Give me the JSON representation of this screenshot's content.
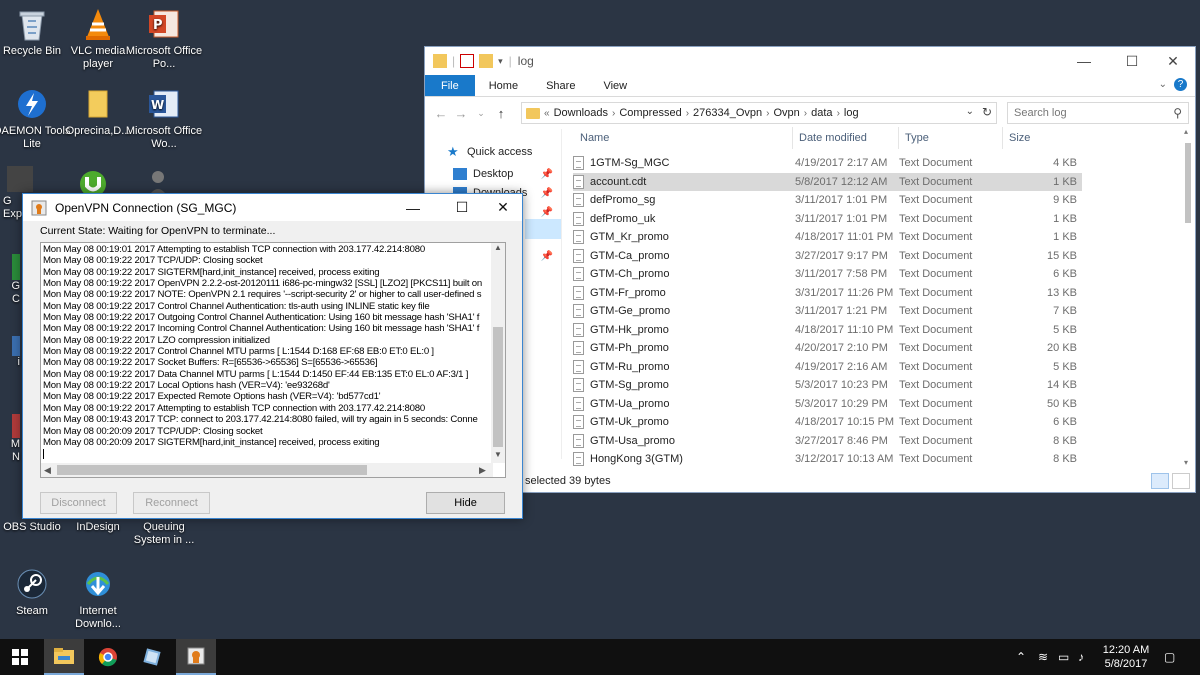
{
  "desktop": {
    "icons": [
      {
        "label": "Recycle Bin",
        "icon": "recycle-bin-icon"
      },
      {
        "label": "VLC media player",
        "icon": "vlc-cone-icon"
      },
      {
        "label": "Microsoft Office Po...",
        "icon": "powerpoint-icon"
      },
      {
        "label": "DAEMON Tools Lite",
        "icon": "daemon-tools-icon"
      },
      {
        "label": "Oprecina,D...",
        "icon": "folder-icon"
      },
      {
        "label": "Microsoft Office Wo...",
        "icon": "word-icon"
      },
      {
        "label": "OBS Studio",
        "icon": "obs-icon"
      },
      {
        "label": "InDesign",
        "icon": "indesign-icon"
      },
      {
        "label": "Queuing System in ...",
        "icon": "queuing-icon"
      },
      {
        "label": "Steam",
        "icon": "steam-icon"
      },
      {
        "label": "Internet Downlo...",
        "icon": "idm-icon"
      }
    ],
    "partial_labels": [
      "G",
      "Exp",
      "G",
      "C",
      "i",
      "M",
      "N"
    ]
  },
  "explorer": {
    "title": "log",
    "ribbon_tabs": [
      "File",
      "Home",
      "Share",
      "View"
    ],
    "address": [
      "Downloads",
      "Compressed",
      "276334_Ovpn",
      "Ovpn",
      "data",
      "log"
    ],
    "address_prefix": "«",
    "search_placeholder": "Search log",
    "nav": {
      "quick_access": "Quick access",
      "desktop": "Desktop",
      "downloads_partial": "Downloads"
    },
    "columns": [
      "Name",
      "Date modified",
      "Type",
      "Size"
    ],
    "files": [
      {
        "name": "1GTM-Sg_MGC",
        "date": "4/19/2017 2:17 AM",
        "type": "Text Document",
        "size": "4 KB"
      },
      {
        "name": "account.cdt",
        "date": "5/8/2017 12:12 AM",
        "type": "Text Document",
        "size": "1 KB"
      },
      {
        "name": "defPromo_sg",
        "date": "3/11/2017 1:01 PM",
        "type": "Text Document",
        "size": "9 KB"
      },
      {
        "name": "defPromo_uk",
        "date": "3/11/2017 1:01 PM",
        "type": "Text Document",
        "size": "1 KB"
      },
      {
        "name": "GTM_Kr_promo",
        "date": "4/18/2017 11:01 PM",
        "type": "Text Document",
        "size": "1 KB"
      },
      {
        "name": "GTM-Ca_promo",
        "date": "3/27/2017 9:17 PM",
        "type": "Text Document",
        "size": "15 KB"
      },
      {
        "name": "GTM-Ch_promo",
        "date": "3/11/2017 7:58 PM",
        "type": "Text Document",
        "size": "6 KB"
      },
      {
        "name": "GTM-Fr_promo",
        "date": "3/31/2017 11:26 PM",
        "type": "Text Document",
        "size": "13 KB"
      },
      {
        "name": "GTM-Ge_promo",
        "date": "3/11/2017 1:21 PM",
        "type": "Text Document",
        "size": "7 KB"
      },
      {
        "name": "GTM-Hk_promo",
        "date": "4/18/2017 11:10 PM",
        "type": "Text Document",
        "size": "5 KB"
      },
      {
        "name": "GTM-Ph_promo",
        "date": "4/20/2017 2:10 PM",
        "type": "Text Document",
        "size": "20 KB"
      },
      {
        "name": "GTM-Ru_promo",
        "date": "4/19/2017 2:16 AM",
        "type": "Text Document",
        "size": "5 KB"
      },
      {
        "name": "GTM-Sg_promo",
        "date": "5/3/2017 10:23 PM",
        "type": "Text Document",
        "size": "14 KB"
      },
      {
        "name": "GTM-Ua_promo",
        "date": "5/3/2017 10:29 PM",
        "type": "Text Document",
        "size": "50 KB"
      },
      {
        "name": "GTM-Uk_promo",
        "date": "4/18/2017 10:15 PM",
        "type": "Text Document",
        "size": "6 KB"
      },
      {
        "name": "GTM-Usa_promo",
        "date": "3/27/2017 8:46 PM",
        "type": "Text Document",
        "size": "8 KB"
      },
      {
        "name": "HongKong 3(GTM)",
        "date": "3/12/2017 10:13 AM",
        "type": "Text Document",
        "size": "8 KB"
      }
    ],
    "status": "selected  39 bytes"
  },
  "vpn": {
    "title": "OpenVPN Connection (SG_MGC)",
    "state": "Current State: Waiting for OpenVPN to terminate...",
    "log": [
      "Mon May 08 00:19:01 2017 Attempting to establish TCP connection with 203.177.42.214:8080",
      "Mon May 08 00:19:22 2017 TCP/UDP: Closing socket",
      "Mon May 08 00:19:22 2017 SIGTERM[hard,init_instance] received, process exiting",
      "Mon May 08 00:19:22 2017 OpenVPN 2.2.2-ost-20120111 i686-pc-mingw32 [SSL] [LZO2] [PKCS11] built on",
      "Mon May 08 00:19:22 2017 NOTE: OpenVPN 2.1 requires '--script-security 2' or higher to call user-defined s",
      "Mon May 08 00:19:22 2017 Control Channel Authentication: tls-auth using INLINE static key file",
      "Mon May 08 00:19:22 2017 Outgoing Control Channel Authentication: Using 160 bit message hash 'SHA1' f",
      "Mon May 08 00:19:22 2017 Incoming Control Channel Authentication: Using 160 bit message hash 'SHA1' f",
      "Mon May 08 00:19:22 2017 LZO compression initialized",
      "Mon May 08 00:19:22 2017 Control Channel MTU parms [ L:1544 D:168 EF:68 EB:0 ET:0 EL:0 ]",
      "Mon May 08 00:19:22 2017 Socket Buffers: R=[65536->65536] S=[65536->65536]",
      "Mon May 08 00:19:22 2017 Data Channel MTU parms [ L:1544 D:1450 EF:44 EB:135 ET:0 EL:0 AF:3/1 ]",
      "Mon May 08 00:19:22 2017 Local Options hash (VER=V4): 'ee93268d'",
      "Mon May 08 00:19:22 2017 Expected Remote Options hash (VER=V4): 'bd577cd1'",
      "Mon May 08 00:19:22 2017 Attempting to establish TCP connection with 203.177.42.214:8080",
      "Mon May 08 00:19:43 2017 TCP: connect to 203.177.42.214:8080 failed, will try again in 5 seconds: Conne",
      "Mon May 08 00:20:09 2017 TCP/UDP: Closing socket",
      "Mon May 08 00:20:09 2017 SIGTERM[hard,init_instance] received, process exiting"
    ],
    "buttons": {
      "disconnect": "Disconnect",
      "reconnect": "Reconnect",
      "hide": "Hide"
    }
  },
  "taskbar": {
    "time": "12:20 AM",
    "date": "5/8/2017"
  }
}
